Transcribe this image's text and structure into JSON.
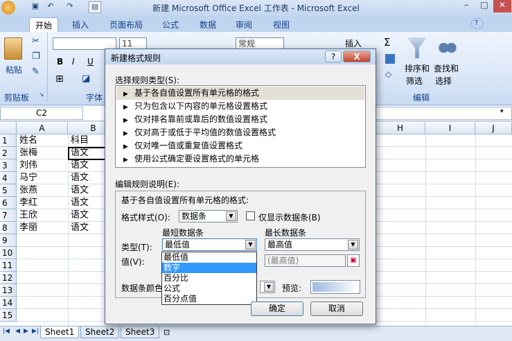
{
  "window": {
    "title": "新建 Microsoft Office Excel 工作表 - Microsoft Excel"
  },
  "ribbon": {
    "tabs": [
      "开始",
      "插入",
      "页面布局",
      "公式",
      "数据",
      "审阅",
      "视图"
    ],
    "active_tab": "开始",
    "paste_label": "粘贴",
    "clipboard_group": "剪贴板",
    "font_group": "字体",
    "font_size": "11",
    "number_format": "常规",
    "insert_label": "插入",
    "sort_label": "排序和\n筛选",
    "sort_label_1": "排序和",
    "sort_label_2": "筛选",
    "find_label_1": "查找和",
    "find_label_2": "选择",
    "edit_group": "编辑"
  },
  "formula_bar": {
    "name_box": "C2"
  },
  "sheet": {
    "columns": [
      "A",
      "B",
      "H",
      "I",
      "J"
    ],
    "rows": [
      "1",
      "2",
      "3",
      "4",
      "5",
      "6",
      "7",
      "8",
      "9",
      "10",
      "11",
      "12",
      "13",
      "14",
      "15"
    ],
    "col_a": [
      "姓名",
      "张梅",
      "刘伟",
      "马宁",
      "张燕",
      "李红",
      "王欣",
      "李丽"
    ],
    "col_b": [
      "科目",
      "语文",
      "语文",
      "语文",
      "语文",
      "语文",
      "语文",
      "语文"
    ],
    "tabs": [
      "Sheet1",
      "Sheet2",
      "Sheet3"
    ]
  },
  "dialog": {
    "title": "新建格式规则",
    "help_button": "?",
    "close_button": "X",
    "select_rule_type_label": "选择规则类型(S):",
    "rule_types": [
      "基于各自值设置所有单元格的格式",
      "只为包含以下内容的单元格设置格式",
      "仅对排名靠前或靠后的数值设置格式",
      "仅对高于或低于平均值的数值设置格式",
      "仅对唯一值或重复值设置格式",
      "使用公式确定要设置格式的单元格"
    ],
    "selected_rule_index": 0,
    "edit_description_label": "编辑规则说明(E):",
    "description_heading": "基于各自值设置所有单元格的格式:",
    "format_style_label": "格式样式(O):",
    "format_style_value": "数据条",
    "show_bar_only_label": "仅显示数据条(B)",
    "show_bar_only_checked": false,
    "shortest_bar_label": "最短数据条",
    "longest_bar_label": "最长数据条",
    "type_label": "类型(T):",
    "value_label": "值(V):",
    "shortest_type_value": "最低值",
    "longest_type_value": "最高值",
    "longest_value_placeholder": "(最高值)",
    "bar_color_label": "数据条颜色",
    "preview_label": "预览:",
    "ok_button": "确定",
    "cancel_button": "取消",
    "dropdown_options": [
      "最低值",
      "数字",
      "百分比",
      "公式",
      "百分点值"
    ],
    "dropdown_highlighted": "数字",
    "bar_color": "#9fb9e0"
  }
}
